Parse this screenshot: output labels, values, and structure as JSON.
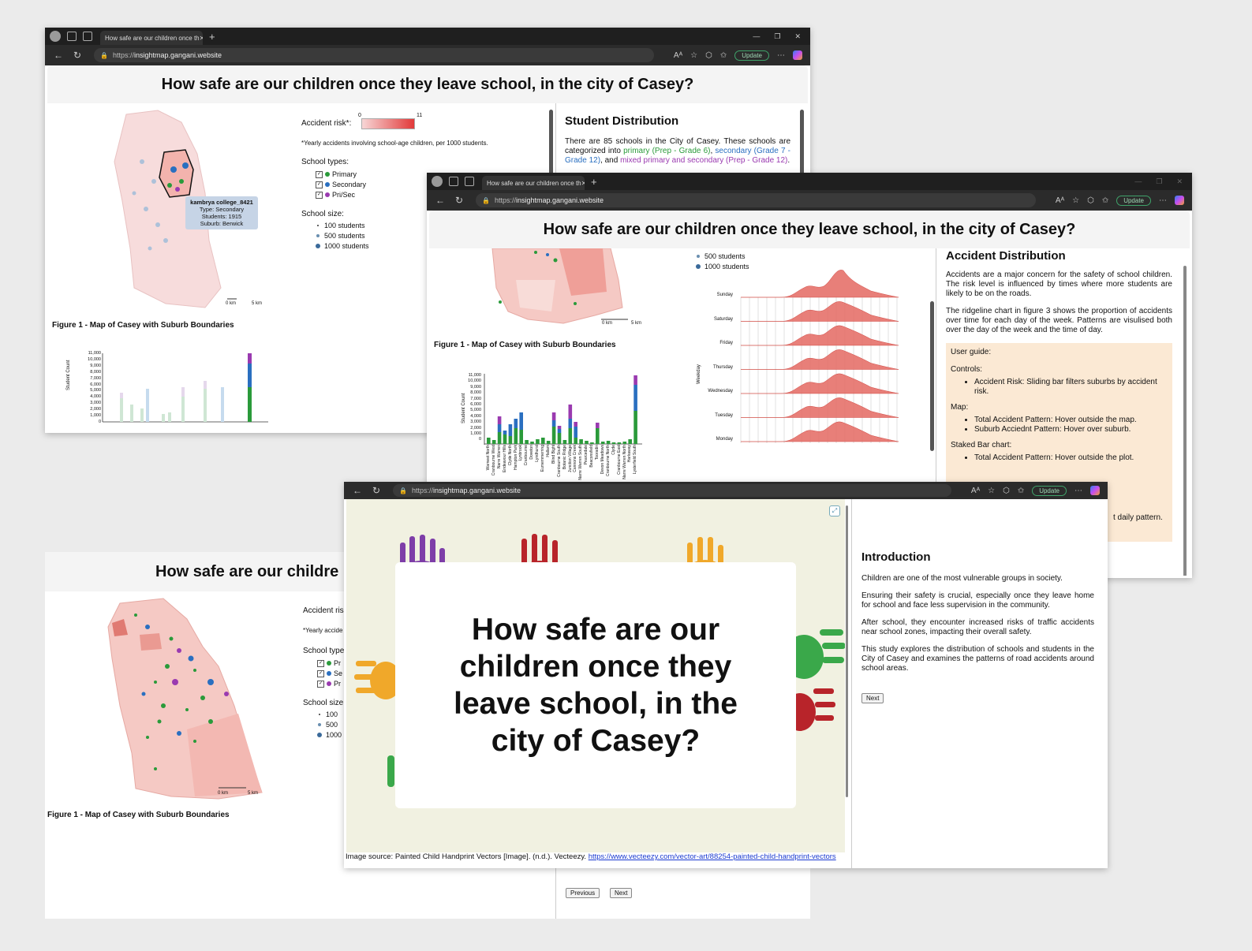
{
  "browser": {
    "tab_title": "How safe are our children once th",
    "tab_close": "✕",
    "new_tab": "+",
    "url_prefix": "https://",
    "url_host": "insightmap.gangani.website",
    "update_label": "Update",
    "more": "⋯",
    "back": "←",
    "refresh": "↻",
    "lock": "🔒",
    "win_min": "—",
    "win_max": "❐",
    "win_close": "✕"
  },
  "page": {
    "title": "How safe are our children once they leave school, in the city of Casey?",
    "title_partial": "How safe are our childre"
  },
  "map_panel": {
    "accident_risk_label": "Accident risk*:",
    "accident_risk_partial": "Accident ris",
    "risk_min": "0",
    "risk_max": "11",
    "footnote": "*Yearly accidents involving school-age children, per 1000 students.",
    "footnote_partial": "*Yearly accide",
    "school_types_label": "School types:",
    "school_types_partial": "School type",
    "types": [
      "Primary",
      "Secondary",
      "Pri/Sec"
    ],
    "types_partial": [
      "Pr",
      "Se",
      "Pr"
    ],
    "school_size_label": "School size:",
    "school_size_partial": "School size",
    "sizes": [
      "100 students",
      "500 students",
      "1000 students"
    ],
    "sizes_partial": [
      "100",
      "500",
      "1000"
    ],
    "scale_0": "0 km",
    "scale_5": "5 km",
    "figure_caption": "Figure 1 - Map of Casey with Suburb Boundaries",
    "tooltip": {
      "name": "kambrya college_8421",
      "type": "Type: Secondary",
      "students": "Students: 1915",
      "suburb": "Suburb: Berwick"
    },
    "colors": {
      "primary": "#2a9a3a",
      "secondary": "#2a6fc0",
      "prisec": "#9a3ab0"
    }
  },
  "bar_chart": {
    "ylabel": "Student Count",
    "yticks": [
      "11,000",
      "10,000",
      "9,000",
      "8,000",
      "7,000",
      "6,000",
      "5,000",
      "4,000",
      "3,000",
      "2,000",
      "1,000",
      "0"
    ]
  },
  "student_distribution": {
    "heading": "Student Distribution",
    "text_1": "There are 85 schools in the City of Casey. These schools are categorized into ",
    "primary": "primary (Prep - Grade 6)",
    "comma": ", ",
    "secondary": "secondary (Grade 7 - Grade 12)",
    "and": ", and ",
    "mixed": "mixed primary and secondary (Prep - Grade 12)",
    "end": "."
  },
  "accident_distribution": {
    "heading": "Accident Distribution",
    "p1": "Accidents are a major concern for the safety of school children. The risk level is influenced by times where more students are likely to be on the roads.",
    "p2": "The ridgeline chart in figure 3 shows the proportion of accidents over time for each day of the week. Patterns are visulised both over the day of the week and the time of day.",
    "guide_title": "User guide:",
    "controls_label": "Controls:",
    "controls_item": "Accident Risk: Sliding bar filters suburbs by accident risk.",
    "map_label": "Map:",
    "map_items": [
      "Total Accident Pattern: Hover outside the map.",
      "Suburb Acciednt Pattern: Hover over suburb."
    ],
    "staked_label": "Staked Bar chart:",
    "staked_items": [
      "Total Accident Pattern: Hover outside the plot."
    ],
    "daily_pattern": "t daily pattern."
  },
  "ridgeline": {
    "ylabel": "Weekday",
    "days": [
      "Sunday",
      "Saturday",
      "Friday",
      "Thursday",
      "Wednesday",
      "Tuesday",
      "Monday"
    ]
  },
  "suburbs": [
    "Warneet North",
    "Cranbourne West",
    "Narre Warren",
    "Endeavour Hills",
    "Clyde North",
    "Hampton Park",
    "Lynbrook",
    "Cranbourne",
    "Doveton",
    "Lyndhurst",
    "Eumemmerring",
    "Hallam",
    "Blind Bight",
    "Cranbourne South",
    "Botanic Ridge",
    "Junction Village",
    "Cannons Creek",
    "Narre Warren South",
    "Pearcedale",
    "Beaconsfield",
    "Tooradin",
    "Devon Meadows",
    "Cranbourne North",
    "Clyde",
    "Cranbourne East",
    "Narre Warren North",
    "Harkaway",
    "Lysterfield South",
    "Pearcedale South",
    "Berwick"
  ],
  "intro": {
    "hero_title": "How safe are our children once they leave school, in the city of Casey?",
    "heading": "Introduction",
    "p1": "Children are one of the most vulnerable groups in society.",
    "p2": "Ensuring their safety is crucial, especially once they leave home for school and face less supervision in the community.",
    "p3": "After school, they encounter increased risks of traffic accidents near school zones, impacting their overall safety.",
    "p4": "This study explores the distribution of schools and students in the City of Casey and examines the patterns of road accidents around school areas.",
    "next": "Next",
    "source_text": "Image source: Painted Child Handprint Vectors [Image]. (n.d.). Vecteezy. ",
    "source_link": "https://www.vecteezy.com/vector-art/88254-painted-child-handprint-vectors"
  },
  "nav_buttons": {
    "previous": "Previous",
    "next": "Next"
  }
}
